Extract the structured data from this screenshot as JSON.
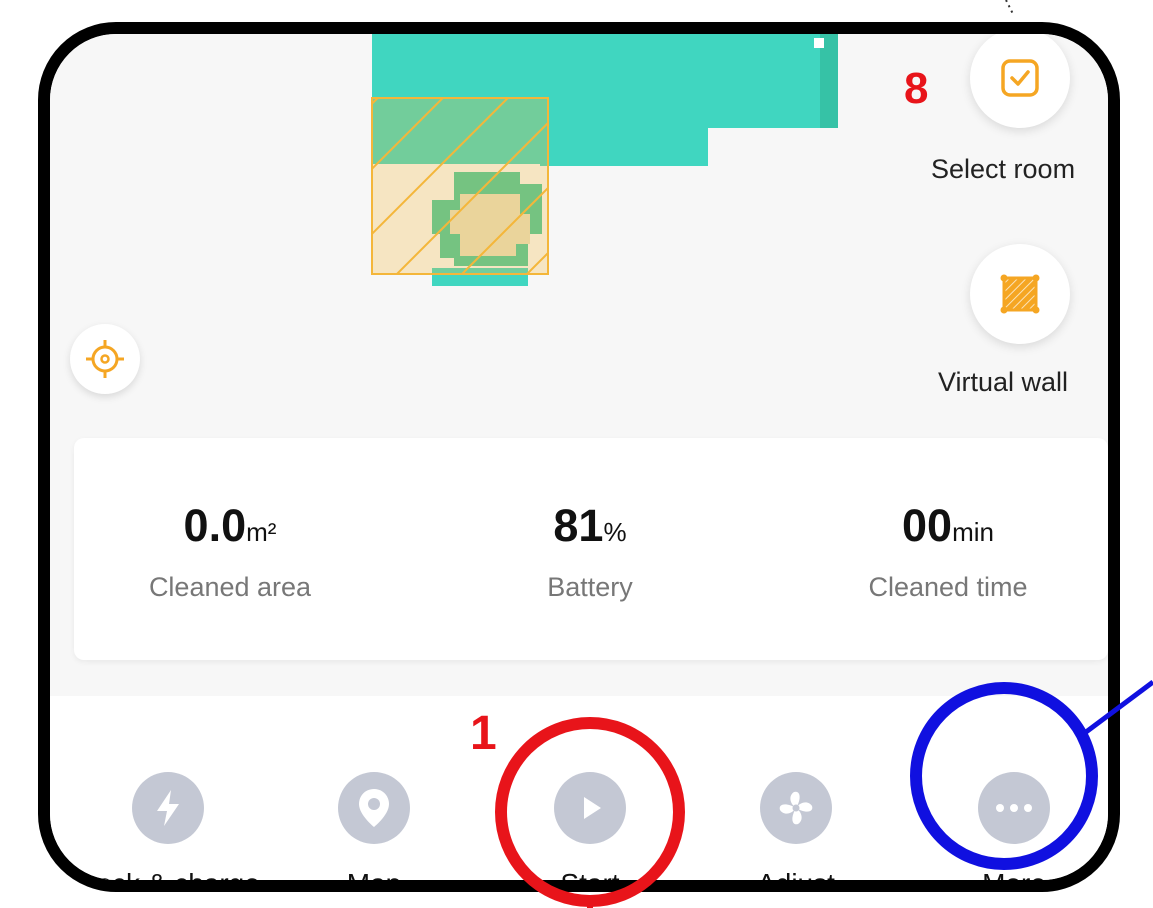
{
  "actions": {
    "select_room": {
      "label": "Select room",
      "icon": "check-square-icon"
    },
    "virtual_wall": {
      "label": "Virtual wall",
      "icon": "virtual-wall-icon"
    },
    "locate": {
      "icon": "crosshair-icon"
    }
  },
  "stats": [
    {
      "value": "0.0",
      "unit": "m²",
      "label": "Cleaned area"
    },
    {
      "value": "81",
      "unit": "%",
      "label": "Battery"
    },
    {
      "value": "00",
      "unit": "min",
      "label": "Cleaned time"
    }
  ],
  "nav": [
    {
      "label": "Dock & charge",
      "icon": "lightning-icon"
    },
    {
      "label": "Map",
      "icon": "map-pin-icon"
    },
    {
      "label": "Start",
      "icon": "play-icon"
    },
    {
      "label": "Adjust",
      "icon": "fan-icon"
    },
    {
      "label": "More",
      "icon": "more-dots-icon"
    }
  ],
  "annotations": {
    "marker_8": "8",
    "marker_1": "1"
  },
  "colors": {
    "map_floor": "#40d6c0",
    "map_edge": "#3cc4a0",
    "selection": "#f4b63a",
    "accent": "#f5a623",
    "nav_icon": "#c4c8d4",
    "annotation_red": "#e8141a",
    "annotation_blue": "#1010e0"
  }
}
